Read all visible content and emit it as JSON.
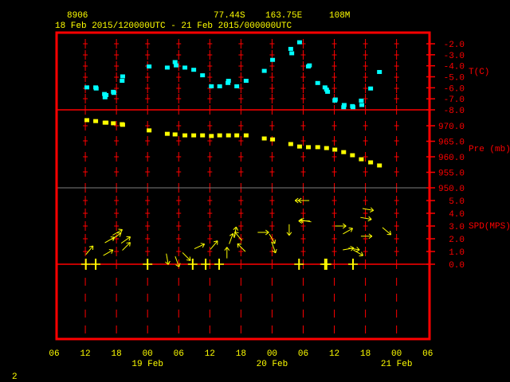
{
  "header": {
    "station": "8906",
    "lat": "77.44S",
    "lon": "163.75E",
    "elev": "108M",
    "period": "18 Feb 2015/120000UTC - 21 Feb 2015/000000UTC"
  },
  "page_number": "2",
  "colors": {
    "frame": "#ff0000",
    "temp": "#00ffff",
    "pressure": "#ffff00",
    "wind": "#ffff00",
    "separator": "#808080"
  },
  "chart_data": [
    {
      "type": "scatter",
      "name": "temperature",
      "ylabel": "T(C)",
      "ylim": [
        -8,
        -2
      ],
      "yticks": [
        "-2.0",
        "-3.0",
        "-4.0",
        "-5.0",
        "-6.0",
        "-7.0",
        "-8.0"
      ],
      "x_unit": "hours since 18 Feb 06 UTC",
      "points": [
        [
          6.3,
          -6.0
        ],
        [
          8.0,
          -6.0
        ],
        [
          8.1,
          -6.1
        ],
        [
          9.7,
          -6.6
        ],
        [
          10.0,
          -6.7
        ],
        [
          9.8,
          -6.9
        ],
        [
          11.4,
          -6.4
        ],
        [
          11.5,
          -6.5
        ],
        [
          13.1,
          -5.4
        ],
        [
          13.2,
          -5.0
        ],
        [
          18.3,
          -4.1
        ],
        [
          21.8,
          -4.2
        ],
        [
          23.3,
          -3.7
        ],
        [
          23.5,
          -4.0
        ],
        [
          25.2,
          -4.2
        ],
        [
          26.9,
          -4.4
        ],
        [
          28.6,
          -4.9
        ],
        [
          30.3,
          -5.9
        ],
        [
          31.9,
          -5.9
        ],
        [
          33.5,
          -5.6
        ],
        [
          33.6,
          -5.4
        ],
        [
          35.2,
          -5.9
        ],
        [
          37.0,
          -5.4
        ],
        [
          40.5,
          -4.5
        ],
        [
          42.1,
          -3.5
        ],
        [
          45.6,
          -2.5
        ],
        [
          45.8,
          -2.9
        ],
        [
          47.3,
          -1.9
        ],
        [
          49.0,
          -4.1
        ],
        [
          49.2,
          -4.0
        ],
        [
          50.8,
          -5.6
        ],
        [
          52.2,
          -6.0
        ],
        [
          52.5,
          -6.2
        ],
        [
          52.7,
          -6.4
        ],
        [
          54.1,
          -7.2
        ],
        [
          54.2,
          -7.1
        ],
        [
          55.8,
          -7.8
        ],
        [
          55.9,
          -7.6
        ],
        [
          57.5,
          -7.7
        ],
        [
          57.6,
          -7.8
        ],
        [
          59.2,
          -7.2
        ],
        [
          59.3,
          -7.6
        ],
        [
          61.0,
          -6.1
        ],
        [
          62.7,
          -4.6
        ]
      ]
    },
    {
      "type": "scatter",
      "name": "pressure",
      "ylabel": "Pre (mb)",
      "ylim": [
        950,
        970
      ],
      "yticks": [
        "970.0",
        "965.0",
        "960.0",
        "955.0",
        "950.0"
      ],
      "points": [
        [
          6.3,
          971.8
        ],
        [
          8.0,
          971.5
        ],
        [
          9.8,
          971.0
        ],
        [
          10.0,
          971.0
        ],
        [
          11.4,
          970.8
        ],
        [
          13.1,
          970.5
        ],
        [
          13.2,
          970.3
        ],
        [
          18.3,
          968.5
        ],
        [
          21.8,
          967.4
        ],
        [
          23.3,
          967.2
        ],
        [
          25.2,
          966.9
        ],
        [
          26.9,
          966.9
        ],
        [
          28.6,
          966.9
        ],
        [
          30.3,
          966.7
        ],
        [
          31.9,
          966.9
        ],
        [
          33.6,
          966.9
        ],
        [
          35.2,
          966.9
        ],
        [
          37.0,
          966.9
        ],
        [
          40.5,
          965.9
        ],
        [
          42.1,
          965.6
        ],
        [
          45.6,
          964.1
        ],
        [
          47.3,
          963.3
        ],
        [
          49.0,
          963.1
        ],
        [
          50.8,
          963.1
        ],
        [
          52.5,
          962.8
        ],
        [
          54.1,
          962.3
        ],
        [
          55.8,
          961.5
        ],
        [
          57.5,
          960.5
        ],
        [
          59.2,
          959.2
        ],
        [
          61.0,
          958.2
        ],
        [
          62.7,
          957.2
        ]
      ]
    },
    {
      "type": "vector",
      "name": "wind",
      "ylabel": "SPD(MPS)",
      "ylim": [
        0,
        5
      ],
      "yticks": [
        "5.0",
        "4.0",
        "3.0",
        "2.0",
        "1.0",
        "0.0"
      ],
      "vectors_hour_speed_todirdeg": [
        [
          6.8,
          1.1,
          40
        ],
        [
          10.4,
          0.9,
          60
        ],
        [
          10.7,
          1.9,
          60
        ],
        [
          12.2,
          2.5,
          60
        ],
        [
          12.0,
          2.2,
          55
        ],
        [
          13.8,
          1.9,
          55
        ],
        [
          13.9,
          1.4,
          45
        ],
        [
          21.8,
          0.4,
          170
        ],
        [
          23.7,
          0.2,
          160
        ],
        [
          25.5,
          0.6,
          135
        ],
        [
          28.0,
          1.4,
          65
        ],
        [
          30.8,
          1.5,
          40
        ],
        [
          33.3,
          0.9,
          0
        ],
        [
          34.1,
          2.0,
          20
        ],
        [
          34.9,
          2.5,
          10
        ],
        [
          35.5,
          2.2,
          320
        ],
        [
          36.1,
          1.3,
          315
        ],
        [
          40.3,
          2.5,
          90
        ],
        [
          42.0,
          2.0,
          150
        ],
        [
          42.3,
          1.3,
          160
        ],
        [
          45.3,
          2.7,
          180
        ],
        [
          47.5,
          5.0,
          270
        ],
        [
          48.1,
          5.0,
          270
        ],
        [
          48.2,
          3.4,
          270
        ],
        [
          48.5,
          3.4,
          280
        ],
        [
          55.2,
          3.0,
          90
        ],
        [
          56.6,
          2.6,
          60
        ],
        [
          56.7,
          1.2,
          80
        ],
        [
          57.8,
          1.2,
          100
        ],
        [
          58.6,
          0.9,
          120
        ],
        [
          60.5,
          4.3,
          100
        ],
        [
          60.1,
          3.6,
          100
        ],
        [
          60.2,
          2.2,
          90
        ],
        [
          64.1,
          2.6,
          130
        ]
      ],
      "calm_hours": [
        6.1,
        8.0,
        18.0,
        26.7,
        29.2,
        31.8,
        47.2,
        52.2,
        52.5,
        57.6
      ]
    }
  ],
  "x_axis": {
    "range_hours": [
      0,
      72
    ],
    "tick_labels": [
      "06",
      "12",
      "18",
      "00",
      "06",
      "12",
      "18",
      "00",
      "06",
      "12",
      "18",
      "00",
      "06"
    ],
    "date_labels": [
      {
        "label": "19 Feb",
        "hour": 18
      },
      {
        "label": "20 Feb",
        "hour": 42
      },
      {
        "label": "21 Feb",
        "hour": 66
      }
    ]
  }
}
